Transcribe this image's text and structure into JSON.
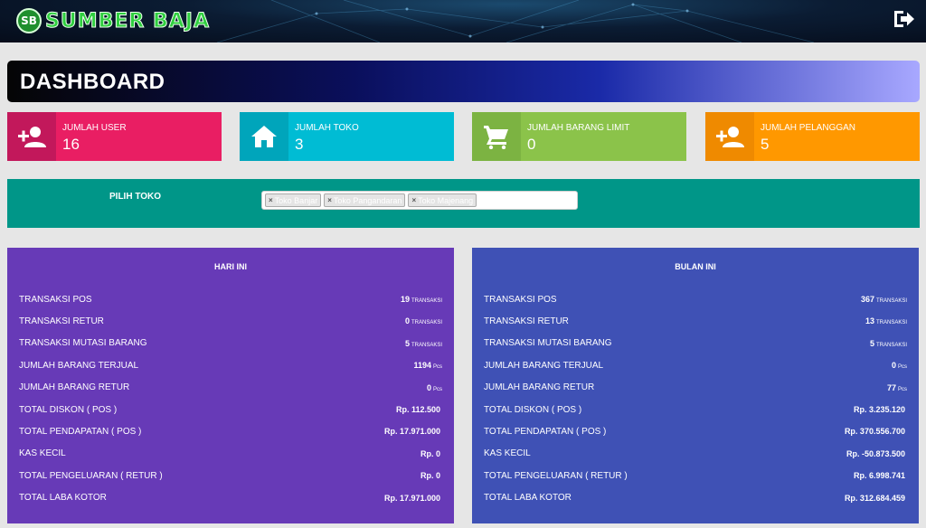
{
  "header": {
    "logo_badge": "SB",
    "brand": "SUMBER BAJA",
    "logout_icon": "logout-icon"
  },
  "page": {
    "title": "DASHBOARD"
  },
  "stats": [
    {
      "label": "JUMLAH USER",
      "value": "16",
      "icon": "user-plus-icon",
      "color": "#e91e63",
      "icon_bg": "#c2185b"
    },
    {
      "label": "JUMLAH TOKO",
      "value": "3",
      "icon": "home-icon",
      "color": "#00bcd4",
      "icon_bg": "#00a5bb"
    },
    {
      "label": "JUMLAH BARANG LIMIT",
      "value": "0",
      "icon": "shopping-cart-icon",
      "color": "#8bc34a",
      "icon_bg": "#7cb342"
    },
    {
      "label": "JUMLAH PELANGGAN",
      "value": "5",
      "icon": "user-plus-icon",
      "color": "#ff9800",
      "icon_bg": "#ef8a00"
    }
  ],
  "store_filter": {
    "label": "PILIH TOKO",
    "selected": [
      "Toko Banjar",
      "Toko Pangandaran",
      "Toko Majenang"
    ]
  },
  "today": {
    "title": "HARI INI",
    "color": "#673ab7",
    "rows": [
      {
        "label": "TRANSAKSI POS",
        "value": "19",
        "unit": "TRANSAKSI"
      },
      {
        "label": "TRANSAKSI RETUR",
        "value": "0",
        "unit": "TRANSAKSI"
      },
      {
        "label": "TRANSAKSI MUTASI BARANG",
        "value": "5",
        "unit": "TRANSAKSI"
      },
      {
        "label": "JUMLAH BARANG TERJUAL",
        "value": "1194",
        "unit": "Pcs"
      },
      {
        "label": "JUMLAH BARANG RETUR",
        "value": "0",
        "unit": "Pcs"
      },
      {
        "label": "TOTAL DISKON ( POS )",
        "value": "Rp. 112.500",
        "unit": ""
      },
      {
        "label": "TOTAL PENDAPATAN ( POS )",
        "value": "Rp. 17.971.000",
        "unit": ""
      },
      {
        "label": "KAS KECIL",
        "value": "Rp. 0",
        "unit": ""
      },
      {
        "label": "TOTAL PENGELUARAN ( RETUR )",
        "value": "Rp. 0",
        "unit": ""
      },
      {
        "label": "TOTAL LABA KOTOR",
        "value": "Rp. 17.971.000",
        "unit": ""
      }
    ]
  },
  "month": {
    "title": "BULAN INI",
    "color": "#3f51b5",
    "rows": [
      {
        "label": "TRANSAKSI POS",
        "value": "367",
        "unit": "TRANSAKSI"
      },
      {
        "label": "TRANSAKSI RETUR",
        "value": "13",
        "unit": "TRANSAKSI"
      },
      {
        "label": "TRANSAKSI MUTASI BARANG",
        "value": "5",
        "unit": "TRANSAKSI"
      },
      {
        "label": "JUMLAH BARANG TERJUAL",
        "value": "0",
        "unit": "Pcs"
      },
      {
        "label": "JUMLAH BARANG RETUR",
        "value": "77",
        "unit": "Pcs"
      },
      {
        "label": "TOTAL DISKON ( POS )",
        "value": "Rp. 3.235.120",
        "unit": ""
      },
      {
        "label": "TOTAL PENDAPATAN ( POS )",
        "value": "Rp. 370.556.700",
        "unit": ""
      },
      {
        "label": "KAS KECIL",
        "value": "Rp. -50.873.500",
        "unit": ""
      },
      {
        "label": "TOTAL PENGELUARAN ( RETUR )",
        "value": "Rp. 6.998.741",
        "unit": ""
      },
      {
        "label": "TOTAL LABA KOTOR",
        "value": "Rp. 312.684.459",
        "unit": ""
      }
    ]
  }
}
